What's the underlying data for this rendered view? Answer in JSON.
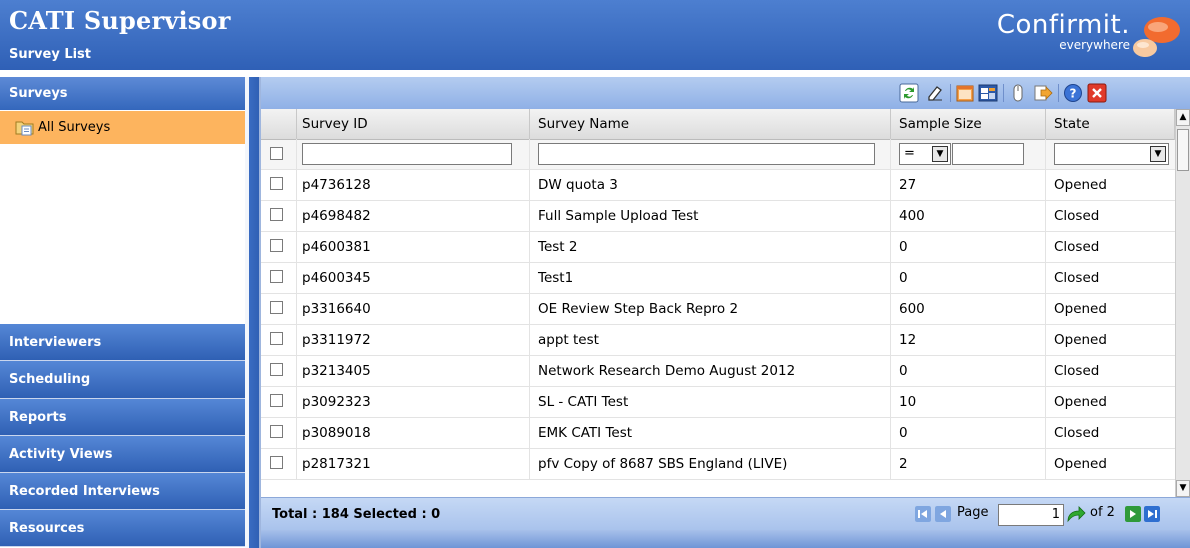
{
  "header": {
    "title": "CATI Supervisor",
    "subtitle": "Survey List",
    "brand_name": "Confirmit.",
    "brand_tagline": "everywhere"
  },
  "sidebar": {
    "section_title": "Surveys",
    "selected_item": "All Surveys",
    "nav_items": [
      {
        "label": "Interviewers"
      },
      {
        "label": "Scheduling"
      },
      {
        "label": "Reports"
      },
      {
        "label": "Activity Views"
      },
      {
        "label": "Recorded Interviews"
      },
      {
        "label": "Resources"
      }
    ]
  },
  "toolbar": {
    "icons": [
      "refresh-icon",
      "eraser-icon",
      "calendar-icon",
      "properties-icon",
      "mouse-icon",
      "export-icon",
      "help-icon",
      "close-icon"
    ]
  },
  "grid": {
    "columns": [
      "Survey ID",
      "Survey Name",
      "Sample Size",
      "State"
    ],
    "filter": {
      "survey_id": "",
      "survey_name": "",
      "size_operator": "=",
      "size_value": "",
      "state": ""
    },
    "rows": [
      {
        "id": "p4736128",
        "name": "DW quota 3",
        "size": "27",
        "state": "Opened"
      },
      {
        "id": "p4698482",
        "name": "Full Sample Upload Test",
        "size": "400",
        "state": "Closed"
      },
      {
        "id": "p4600381",
        "name": "Test 2",
        "size": "0",
        "state": "Closed"
      },
      {
        "id": "p4600345",
        "name": "Test1",
        "size": "0",
        "state": "Closed"
      },
      {
        "id": "p3316640",
        "name": "OE Review Step Back Repro 2",
        "size": "600",
        "state": "Opened"
      },
      {
        "id": "p3311972",
        "name": "appt test",
        "size": "12",
        "state": "Opened"
      },
      {
        "id": "p3213405",
        "name": "Network Research Demo August 2012",
        "size": "0",
        "state": "Closed"
      },
      {
        "id": "p3092323",
        "name": "SL - CATI Test",
        "size": "10",
        "state": "Opened"
      },
      {
        "id": "p3089018",
        "name": "EMK CATI Test",
        "size": "0",
        "state": "Closed"
      },
      {
        "id": "p2817321",
        "name": "pfv Copy of 8687 SBS England (LIVE)",
        "size": "2",
        "state": "Opened"
      }
    ]
  },
  "footer": {
    "total_text": "Total : 184 Selected : 0",
    "page_label": "Page",
    "page_value": "1",
    "of_text": "of 2"
  },
  "colors": {
    "header_blue": "#2f60b6",
    "selected_orange": "#fdb45e",
    "toolbar_blue": "#a3bfeb"
  }
}
